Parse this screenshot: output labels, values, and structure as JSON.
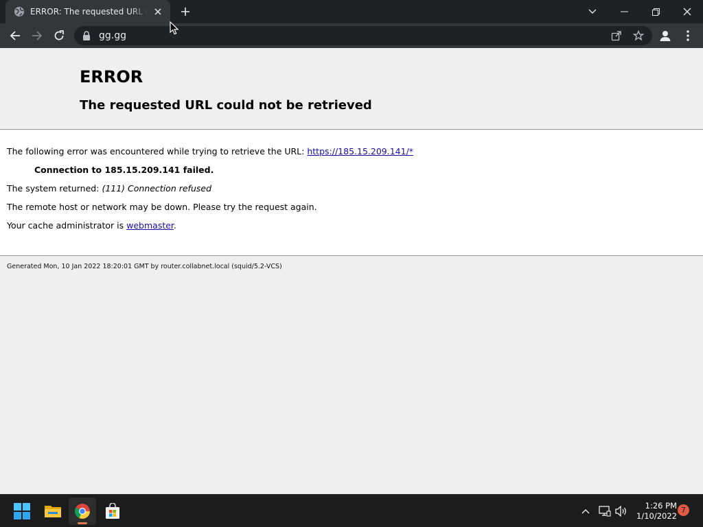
{
  "browser": {
    "tab_title": "ERROR: The requested URL could not be retrieved",
    "url": "gg.gg"
  },
  "page": {
    "h1": "ERROR",
    "h2": "The requested URL could not be retrieved",
    "line1_text": "The following error was encountered while trying to retrieve the URL:",
    "line1_link": "https://185.15.209.141/*",
    "line2": "Connection to 185.15.209.141 failed.",
    "line3_prefix": "The system returned:",
    "line3_detail": "(111) Connection refused",
    "line4": "The remote host or network may be down. Please try the request again.",
    "line5_prefix": "Your cache administrator is",
    "line5_link": "webmaster",
    "line5_suffix": ".",
    "footer": "Generated Mon, 10 Jan 2022 18:20:01 GMT by router.collabnet.local (squid/5.2-VCS)"
  },
  "taskbar": {
    "time": "1:26 PM",
    "date": "1/10/2022",
    "notification_count": "7",
    "apps": [
      "start-icon",
      "file-explorer-icon",
      "chrome-icon",
      "store-icon"
    ]
  },
  "colors": {
    "link": "#1a0dab",
    "page_bg": "#efefef",
    "accent_indicator": "#e07b53"
  }
}
